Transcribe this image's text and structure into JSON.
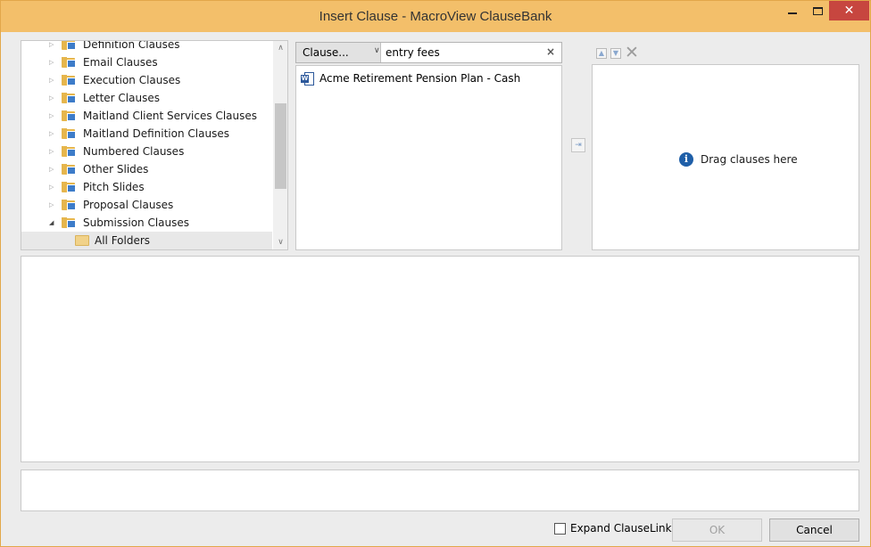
{
  "window": {
    "title": "Insert Clause - MacroView ClauseBank",
    "minimize": "—",
    "maximize": "□",
    "close": "✕"
  },
  "tree": {
    "items": [
      {
        "label": "Definition Clauses",
        "expanded": false
      },
      {
        "label": "Email Clauses",
        "expanded": false
      },
      {
        "label": "Execution Clauses",
        "expanded": false
      },
      {
        "label": "Letter Clauses",
        "expanded": false
      },
      {
        "label": "Maitland Client Services Clauses",
        "expanded": false
      },
      {
        "label": "Maitland Definition Clauses",
        "expanded": false
      },
      {
        "label": "Numbered Clauses",
        "expanded": false
      },
      {
        "label": "Other Slides",
        "expanded": false
      },
      {
        "label": "Pitch Slides",
        "expanded": false
      },
      {
        "label": "Proposal Clauses",
        "expanded": false
      },
      {
        "label": "Submission Clauses",
        "expanded": true
      }
    ],
    "selected": {
      "label": "All Folders"
    }
  },
  "search": {
    "type_selected": "Clause...",
    "query": "entry fees",
    "clear_icon": "×"
  },
  "results": [
    {
      "label": "Acme Retirement Pension Plan - Cash",
      "icon": "word-doc-icon"
    }
  ],
  "dropzone": {
    "message": "Drag clauses here",
    "info_icon": "i"
  },
  "footer": {
    "expand_label": "Expand ClauseLinks",
    "expand_checked": false,
    "ok_label": "OK",
    "ok_enabled": false,
    "cancel_label": "Cancel"
  },
  "colors": {
    "titlebar": "#f3bf6a",
    "close_button": "#c7463f",
    "info_icon": "#1f5fa8"
  }
}
